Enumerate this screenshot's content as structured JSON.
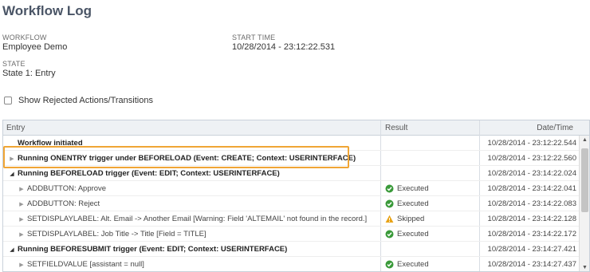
{
  "page": {
    "title": "Workflow Log"
  },
  "meta": {
    "workflow_label": "WORKFLOW",
    "workflow_value": "Employee Demo",
    "start_time_label": "START TIME",
    "start_time_value": "10/28/2014 - 23:12:22.531",
    "state_label": "STATE",
    "state_value": "State 1: Entry"
  },
  "options": {
    "show_rejected_label": "Show Rejected Actions/Transitions",
    "show_rejected_checked": false
  },
  "grid": {
    "columns": {
      "entry": "Entry",
      "result": "Result",
      "date": "Date/Time"
    },
    "rows": [
      {
        "entry": "Workflow initiated",
        "bold": true,
        "arrow": "none",
        "result": "",
        "result_icon": "",
        "date": "10/28/2014 - 23:12:22.544"
      },
      {
        "entry": "Running ONENTRY trigger under BEFORELOAD (Event: CREATE; Context: USERINTERFACE)",
        "bold": true,
        "arrow": "right",
        "result": "",
        "result_icon": "",
        "date": "10/28/2014 - 23:12:22.560"
      },
      {
        "entry": "Running BEFORELOAD trigger (Event: EDIT; Context: USERINTERFACE)",
        "bold": true,
        "arrow": "down",
        "result": "",
        "result_icon": "",
        "date": "10/28/2014 - 23:14:22.024"
      },
      {
        "entry": "ADDBUTTON: Approve",
        "bold": false,
        "arrow": "right",
        "result": "Executed",
        "result_icon": "check-icon",
        "date": "10/28/2014 - 23:14:22.041"
      },
      {
        "entry": "ADDBUTTON: Reject",
        "bold": false,
        "arrow": "right",
        "result": "Executed",
        "result_icon": "check-icon",
        "date": "10/28/2014 - 23:14:22.083"
      },
      {
        "entry": "SETDISPLAYLABEL: Alt. Email -> Another Email [Warning: Field 'ALTEMAIL' not found in the record.]",
        "bold": false,
        "arrow": "right",
        "result": "Skipped",
        "result_icon": "warning-icon",
        "date": "10/28/2014 - 23:14:22.128"
      },
      {
        "entry": "SETDISPLAYLABEL: Job Title -> Title [Field = TITLE]",
        "bold": false,
        "arrow": "right",
        "result": "Executed",
        "result_icon": "check-icon",
        "date": "10/28/2014 - 23:14:22.172"
      },
      {
        "entry": "Running BEFORESUBMIT trigger (Event: EDIT; Context: USERINTERFACE)",
        "bold": true,
        "arrow": "down",
        "result": "",
        "result_icon": "",
        "date": "10/28/2014 - 23:14:27.421"
      },
      {
        "entry": "SETFIELDVALUE [assistant = null]",
        "bold": false,
        "arrow": "right",
        "result": "Executed",
        "result_icon": "check-icon",
        "date": "10/28/2014 - 23:14:27.437"
      }
    ]
  },
  "colors": {
    "title": "#4a5566",
    "highlight": "#f0a535",
    "success": "#3a9a3a",
    "warning": "#e8a317"
  }
}
